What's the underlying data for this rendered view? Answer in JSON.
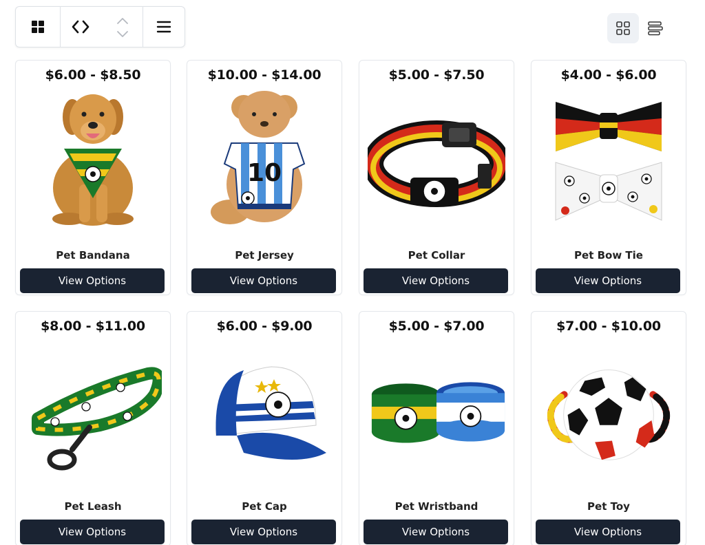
{
  "toolbar": {
    "icons": [
      "grid-icon",
      "code-icon",
      "sort-updown-icon",
      "menu-icon"
    ]
  },
  "view_toggle": {
    "icons": [
      "grid-view-icon",
      "list-view-icon"
    ],
    "active": "grid"
  },
  "products": [
    {
      "price": "$6.00 - $8.50",
      "name": "Pet Bandana",
      "button": "View Options",
      "image": "dog-bandana"
    },
    {
      "price": "$10.00 - $14.00",
      "name": "Pet Jersey",
      "button": "View Options",
      "image": "dog-jersey"
    },
    {
      "price": "$5.00 - $7.50",
      "name": "Pet Collar",
      "button": "View Options",
      "image": "collar"
    },
    {
      "price": "$4.00 - $6.00",
      "name": "Pet Bow Tie",
      "button": "View Options",
      "image": "bow-ties"
    },
    {
      "price": "$8.00 - $11.00",
      "name": "Pet Leash",
      "button": "View Options",
      "image": "leash"
    },
    {
      "price": "$6.00 - $9.00",
      "name": "Pet Cap",
      "button": "View Options",
      "image": "cap"
    },
    {
      "price": "$5.00 - $7.00",
      "name": "Pet Wristband",
      "button": "View Options",
      "image": "wristbands"
    },
    {
      "price": "$7.00 - $10.00",
      "name": "Pet Toy",
      "button": "View Options",
      "image": "ball-toy"
    }
  ],
  "colors": {
    "button_bg": "#1a2332",
    "border": "#e4e7eb",
    "toggle_active_bg": "#eef1f5"
  }
}
